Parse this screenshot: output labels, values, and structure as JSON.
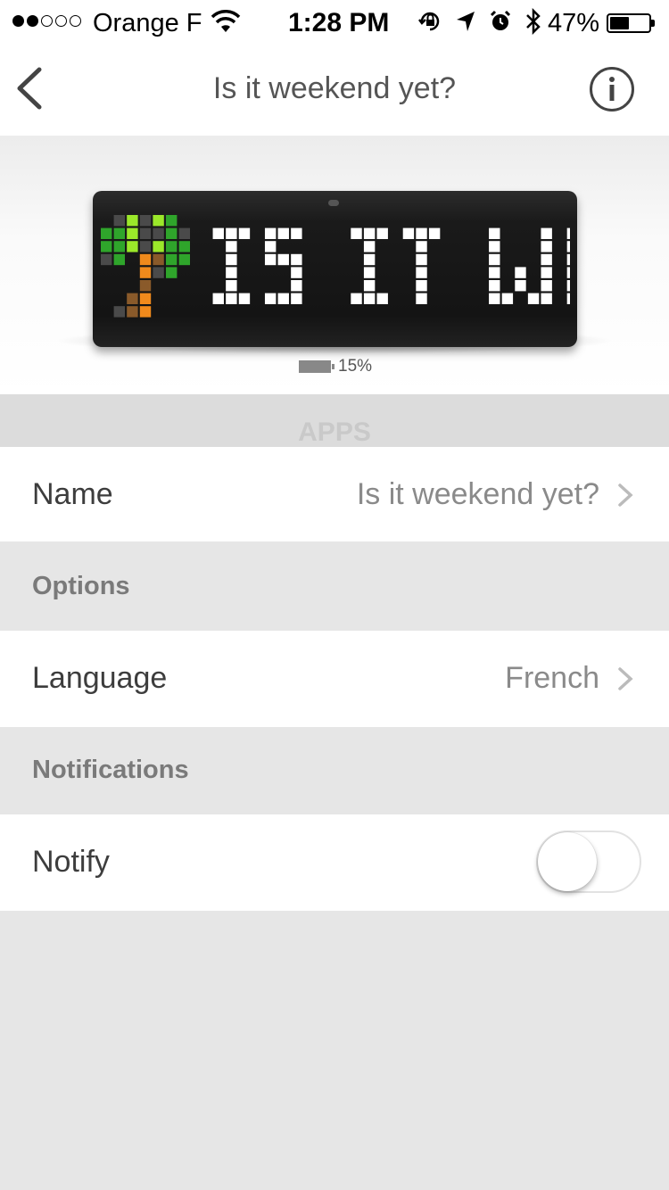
{
  "status_bar": {
    "carrier": "Orange F",
    "time": "1:28 PM",
    "battery": "47%",
    "signal_bars_filled": 2,
    "signal_bars_total": 5
  },
  "nav": {
    "title": "Is it weekend yet?",
    "back_icon": "chevron-left-icon",
    "info_icon": "info-icon"
  },
  "device": {
    "display_text": "IS IT WEE",
    "battery_level": "15%",
    "accent_colors": [
      "#2fa52b",
      "#9be82a",
      "#f08a1c",
      "#8a5a2a"
    ]
  },
  "apps_header": "APPS",
  "name_row": {
    "label": "Name",
    "value": "Is it weekend yet?"
  },
  "options_header": "Options",
  "language_row": {
    "label": "Language",
    "value": "French"
  },
  "notifications_header": "Notifications",
  "notify_row": {
    "label": "Notify",
    "enabled": false
  }
}
